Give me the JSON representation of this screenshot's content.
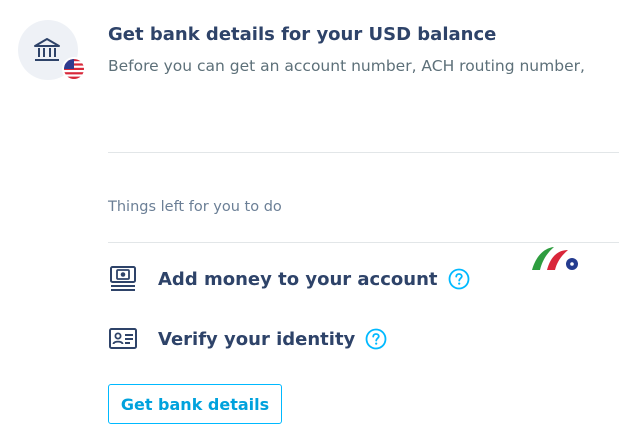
{
  "header": {
    "title": "Get bank details for your USD balance",
    "description": "Before you can get an account number, ACH routing number,"
  },
  "todo": {
    "heading": "Things left for you to do",
    "items": [
      {
        "label": "Add money to your account",
        "icon": "cash-icon"
      },
      {
        "label": "Verify your identity",
        "icon": "id-card-icon"
      }
    ]
  },
  "actions": {
    "get_bank_details_label": "Get bank details"
  },
  "colors": {
    "title": "#2e4369",
    "accent": "#00a2dd",
    "muted": "#6b7f96",
    "badge_bg": "#eef1f6"
  }
}
